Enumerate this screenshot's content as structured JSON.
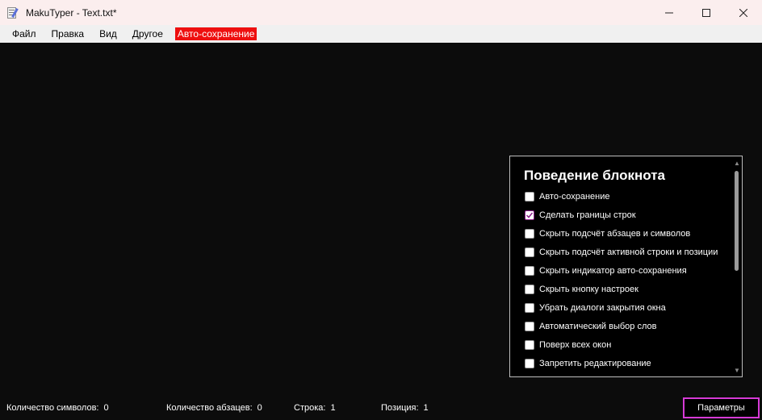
{
  "window": {
    "title": "MakuTyper - Text.txt*",
    "app_icon": "notepad-icon"
  },
  "menu": {
    "items": [
      "Файл",
      "Правка",
      "Вид",
      "Другое"
    ],
    "autosave_label": "Авто-сохранение",
    "autosave_color": "#ee0f0f"
  },
  "settings_panel": {
    "title": "Поведение блокнота",
    "options": [
      {
        "label": "Авто-сохранение",
        "checked": false
      },
      {
        "label": "Сделать границы строк",
        "checked": true
      },
      {
        "label": "Скрыть подсчёт абзацев и символов",
        "checked": false
      },
      {
        "label": "Скрыть подсчёт активной строки и позиции",
        "checked": false
      },
      {
        "label": "Скрыть индикатор авто-сохранения",
        "checked": false
      },
      {
        "label": "Скрыть кнопку настроек",
        "checked": false
      },
      {
        "label": "Убрать диалоги закрытия окна",
        "checked": false
      },
      {
        "label": "Автоматический выбор слов",
        "checked": false
      },
      {
        "label": "Поверх всех окон",
        "checked": false
      },
      {
        "label": "Запретить редактирование",
        "checked": false
      }
    ]
  },
  "status": {
    "chars_label": "Количество символов:",
    "chars_value": "0",
    "paragraphs_label": "Количество абзацев:",
    "paragraphs_value": "0",
    "line_label": "Строка:",
    "line_value": "1",
    "position_label": "Позиция:",
    "position_value": "1",
    "params_button": "Параметры",
    "accent_color": "#d63ad6"
  }
}
